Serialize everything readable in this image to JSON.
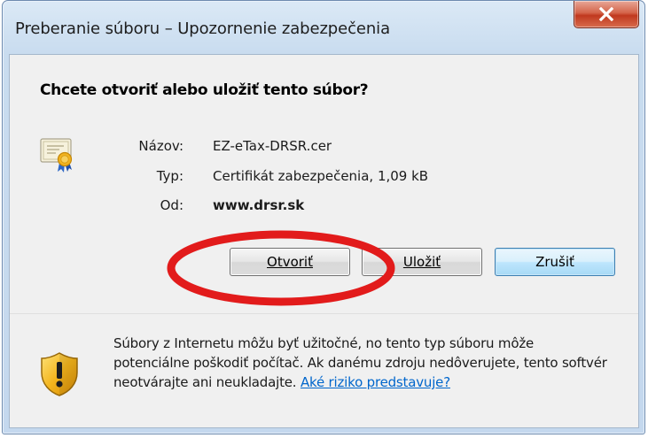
{
  "window": {
    "title": "Preberanie súboru – Upozornenie zabezpečenia"
  },
  "dialog": {
    "question": "Chcete otvoriť alebo uložiť tento súbor?",
    "file_icon": "certificate-icon",
    "fields": {
      "name_label": "Názov:",
      "name_value": "EZ-eTax-DRSR.cer",
      "type_label": "Typ:",
      "type_value": "Certifikát zabezpečenia, 1,09 kB",
      "from_label": "Od:",
      "from_value": "www.drsr.sk"
    },
    "buttons": {
      "open": "Otvoriť",
      "save": "Uložiť",
      "cancel": "Zrušiť"
    },
    "warning": {
      "icon": "shield-warning-icon",
      "text": "Súbory z Internetu môžu byť užitočné, no tento typ súboru môže potenciálne poškodiť počítač. Ak danému zdroju nedôverujete, tento softvér neotvárajte ani neukladajte.",
      "link": "Aké riziko predstavuje?"
    }
  },
  "colors": {
    "annotation": "#e21b1b",
    "link": "#0066cc",
    "close_button": "#c0391f"
  }
}
